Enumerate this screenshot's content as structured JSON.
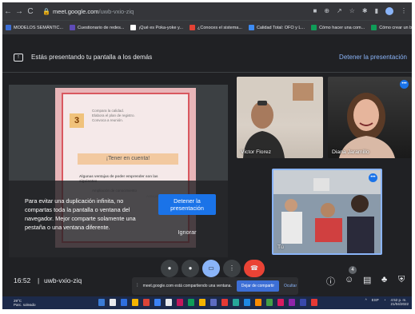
{
  "browser": {
    "url_host": "meet.google.com",
    "url_path": "/uwb-vxio-ziq",
    "bookmarks": [
      {
        "label": "MODELOS SEMÁNTIC...",
        "color": "#3d6fd6"
      },
      {
        "label": "Cuestionario de redes...",
        "color": "#5e4bb7"
      },
      {
        "label": "¡Qué es Poka-yoke y...",
        "color": "#ffffff"
      },
      {
        "label": "¿Conoces el sistema...",
        "color": "#e34234"
      },
      {
        "label": "Calidad Total: OFO y L...",
        "color": "#3d8bf2"
      },
      {
        "label": "Cómo hacer una com...",
        "color": "#0f9d58"
      },
      {
        "label": "Cómo crear un bailet...",
        "color": "#0f9d58"
      }
    ]
  },
  "banner": {
    "text": "Estás presentando tu pantalla a los demás",
    "stop_label": "Detener la presentación"
  },
  "slide": {
    "number": "3",
    "list_lines": [
      "Compara la calidad.",
      "Elabora el plan de registro.",
      "Convoca a reunión."
    ],
    "tener": "¡Tener en cuenta!",
    "ventajas": "Algunas ventajas de poder emprender son las siguientes",
    "ampliacion": "Ampliación de conocimiento",
    "autogestion": "Autogestión"
  },
  "dialog": {
    "message": "Para evitar una duplicación infinita, no compartas toda la pantalla o ventana del navegador. Mejor comparte solamente una pestaña o una ventana diferente.",
    "stop_label": "Detener la presentación",
    "ignore_label": "Ignorar"
  },
  "participants": [
    {
      "name": "Victor Florez"
    },
    {
      "name": "Diana Jaramillo"
    },
    {
      "name": "Tú"
    }
  ],
  "meeting": {
    "time": "16:52",
    "code": "uwb-vxio-ziq",
    "people_count": "4"
  },
  "share_bar": {
    "text": "meet.google.com está compartiendo una ventana.",
    "stop_label": "Dejar de compartir",
    "hide_label": "Ocultar"
  },
  "taskbar": {
    "weather_temp": "29°C",
    "weather_desc": "Parc. soleado",
    "lang": "ESP",
    "clock_time": "4:52 p. m.",
    "clock_date": "21/04/2022"
  },
  "colors": {
    "meet_bg": "#202124",
    "accent": "#1a73e8",
    "link": "#8ab4f8",
    "end_call": "#ea4335"
  }
}
